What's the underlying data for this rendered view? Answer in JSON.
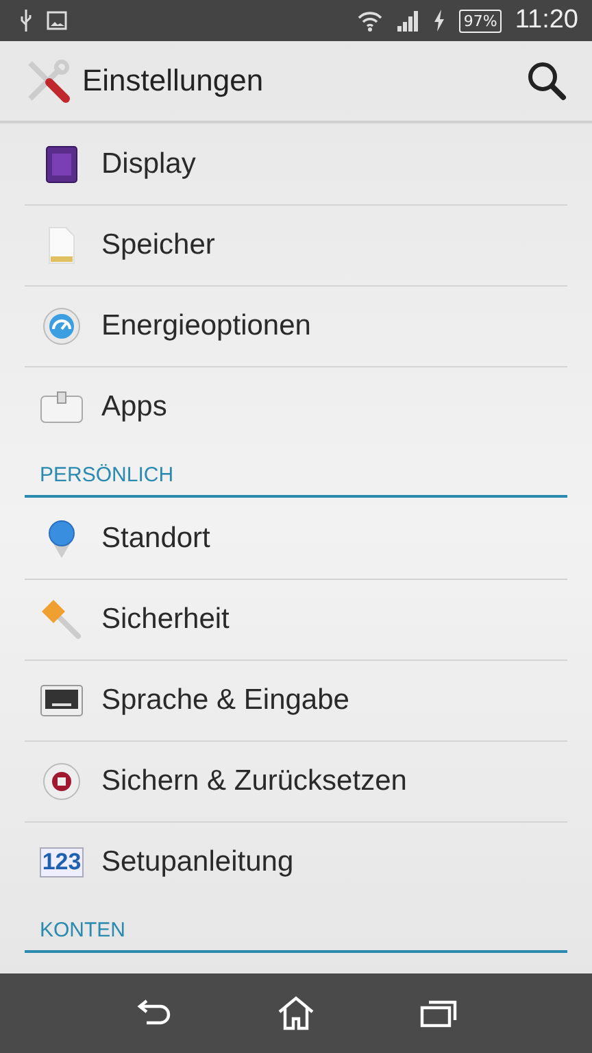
{
  "status_bar": {
    "battery": "97%",
    "time": "11:20"
  },
  "action_bar": {
    "title": "Einstellungen"
  },
  "entries": [
    {
      "kind": "item",
      "label": "Display"
    },
    {
      "kind": "item",
      "label": "Speicher"
    },
    {
      "kind": "item",
      "label": "Energieoptionen"
    },
    {
      "kind": "item",
      "label": "Apps"
    },
    {
      "kind": "header",
      "label": "PERSÖNLICH"
    },
    {
      "kind": "item",
      "label": "Standort"
    },
    {
      "kind": "item",
      "label": "Sicherheit"
    },
    {
      "kind": "item",
      "label": "Sprache & Eingabe"
    },
    {
      "kind": "item",
      "label": "Sichern & Zurücksetzen"
    },
    {
      "kind": "item",
      "label": "Setupanleitung",
      "icon_text": "123"
    },
    {
      "kind": "header",
      "label": "KONTEN"
    }
  ]
}
